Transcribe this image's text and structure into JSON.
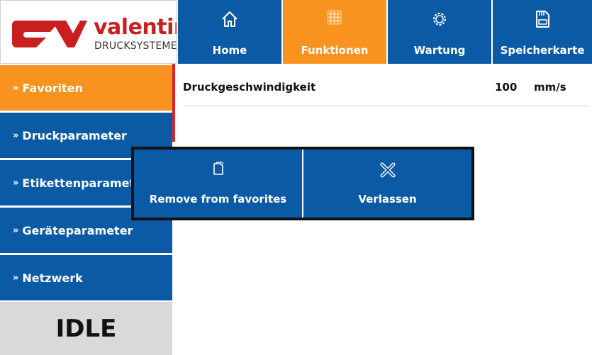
{
  "logo": {
    "name": "valentin",
    "subtitle": "DRUCKSYSTEME",
    "brand_color": "#c9201f"
  },
  "topnav": {
    "tabs": [
      {
        "label": "Home",
        "icon": "home-icon",
        "active": false
      },
      {
        "label": "Funktionen",
        "icon": "grid-icon",
        "active": true
      },
      {
        "label": "Wartung",
        "icon": "gear-icon",
        "active": false
      },
      {
        "label": "Speicherkarte",
        "icon": "memory-card-icon",
        "active": false
      }
    ]
  },
  "sidebar": {
    "items": [
      {
        "label": "Favoriten",
        "active": true
      },
      {
        "label": "Druckparameter",
        "active": false
      },
      {
        "label": "Etikettenparameter",
        "active": false
      },
      {
        "label": "Geräteparameter",
        "active": false
      },
      {
        "label": "Netzwerk",
        "active": false
      }
    ],
    "chevron": "»"
  },
  "status": {
    "text": "IDLE"
  },
  "content": {
    "rows": [
      {
        "name": "Druckgeschwindigkeit",
        "value": "100",
        "unit": "mm/s"
      }
    ]
  },
  "popup": {
    "remove_label": "Remove from favorites",
    "remove_icon": "page-icon",
    "exit_label": "Verlassen",
    "exit_icon": "close-icon"
  },
  "colors": {
    "primary_blue": "#0a5aa6",
    "accent_orange": "#f7931e",
    "status_grey": "#d9d9d9",
    "divider_red": "#d9232d"
  }
}
